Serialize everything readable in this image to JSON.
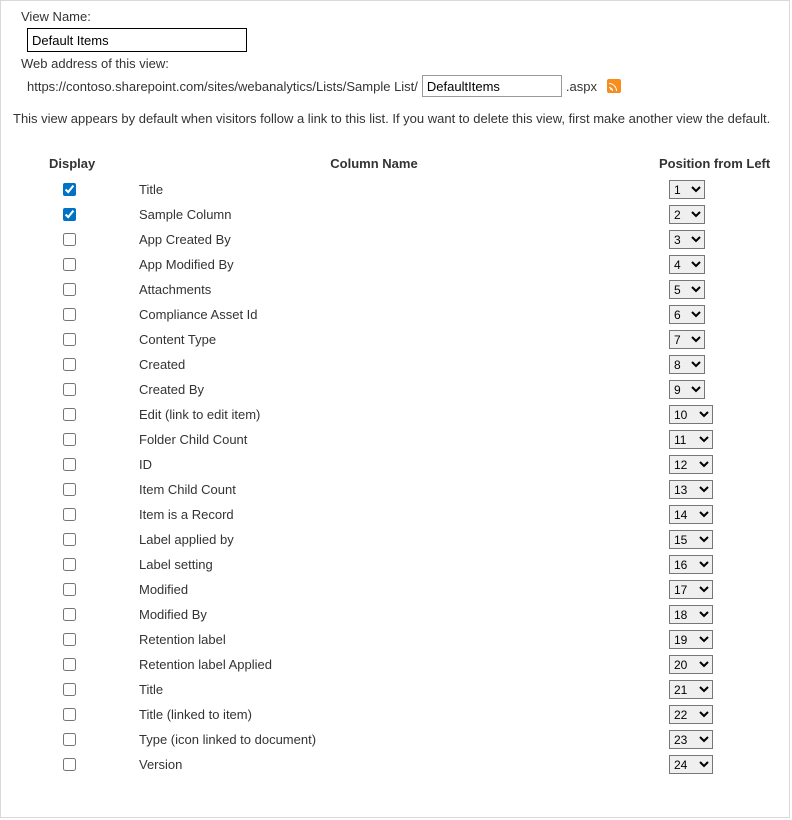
{
  "viewName": {
    "label": "View Name:",
    "value": "Default Items"
  },
  "webAddress": {
    "label": "Web address of this view:",
    "urlPrefix": "https://contoso.sharepoint.com/sites/webanalytics/Lists/Sample List/",
    "inputValue": "DefaultItems",
    "urlSuffix": ".aspx"
  },
  "description": "This view appears by default when visitors follow a link to this list. If you want to delete this view, first make another view the default.",
  "headers": {
    "display": "Display",
    "columnName": "Column Name",
    "position": "Position from Left"
  },
  "maxPosition": 24,
  "columns": [
    {
      "checked": true,
      "name": "Title",
      "pos": 1
    },
    {
      "checked": true,
      "name": "Sample Column",
      "pos": 2
    },
    {
      "checked": false,
      "name": "App Created By",
      "pos": 3
    },
    {
      "checked": false,
      "name": "App Modified By",
      "pos": 4
    },
    {
      "checked": false,
      "name": "Attachments",
      "pos": 5
    },
    {
      "checked": false,
      "name": "Compliance Asset Id",
      "pos": 6
    },
    {
      "checked": false,
      "name": "Content Type",
      "pos": 7
    },
    {
      "checked": false,
      "name": "Created",
      "pos": 8
    },
    {
      "checked": false,
      "name": "Created By",
      "pos": 9
    },
    {
      "checked": false,
      "name": "Edit (link to edit item)",
      "pos": 10
    },
    {
      "checked": false,
      "name": "Folder Child Count",
      "pos": 11
    },
    {
      "checked": false,
      "name": "ID",
      "pos": 12
    },
    {
      "checked": false,
      "name": "Item Child Count",
      "pos": 13
    },
    {
      "checked": false,
      "name": "Item is a Record",
      "pos": 14
    },
    {
      "checked": false,
      "name": "Label applied by",
      "pos": 15
    },
    {
      "checked": false,
      "name": "Label setting",
      "pos": 16
    },
    {
      "checked": false,
      "name": "Modified",
      "pos": 17
    },
    {
      "checked": false,
      "name": "Modified By",
      "pos": 18
    },
    {
      "checked": false,
      "name": "Retention label",
      "pos": 19
    },
    {
      "checked": false,
      "name": "Retention label Applied",
      "pos": 20
    },
    {
      "checked": false,
      "name": "Title",
      "pos": 21
    },
    {
      "checked": false,
      "name": "Title (linked to item)",
      "pos": 22
    },
    {
      "checked": false,
      "name": "Type (icon linked to document)",
      "pos": 23
    },
    {
      "checked": false,
      "name": "Version",
      "pos": 24
    }
  ]
}
